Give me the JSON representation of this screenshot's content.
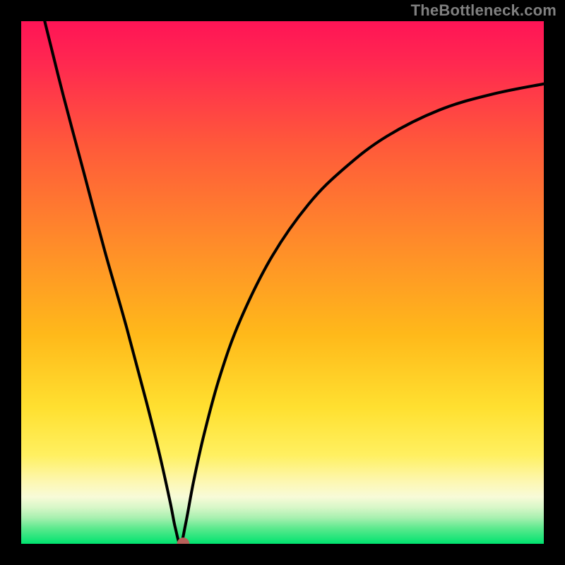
{
  "watermark": "TheBottleneck.com",
  "chart_data": {
    "type": "line",
    "title": "",
    "xlabel": "",
    "ylabel": "",
    "xlim": [
      0,
      100
    ],
    "ylim": [
      0,
      100
    ],
    "gradient_zones": [
      {
        "name": "bottleneck-high",
        "color": "#ff1744",
        "position": 0
      },
      {
        "name": "bottleneck-mid",
        "color": "#ffab00",
        "position": 50
      },
      {
        "name": "bottleneck-low",
        "color": "#ffee58",
        "position": 80
      },
      {
        "name": "optimal",
        "color": "#00e676",
        "position": 100
      }
    ],
    "min_point": {
      "x": 30.5,
      "y": 0
    },
    "marker": {
      "x": 31,
      "y": 0,
      "color": "#b8615a",
      "radius": 1.2
    },
    "series": [
      {
        "name": "bottleneck-curve",
        "x": [
          4.5,
          8,
          12,
          16,
          20,
          24,
          26.5,
          28.5,
          29.5,
          30.5,
          31.5,
          33,
          35,
          38,
          42,
          48,
          55,
          62,
          70,
          80,
          90,
          100
        ],
        "values": [
          100,
          86,
          71,
          56,
          42,
          27,
          17,
          8,
          3,
          0,
          4,
          12,
          21,
          32,
          43,
          55,
          65,
          72,
          78,
          83,
          86,
          88
        ]
      }
    ]
  }
}
